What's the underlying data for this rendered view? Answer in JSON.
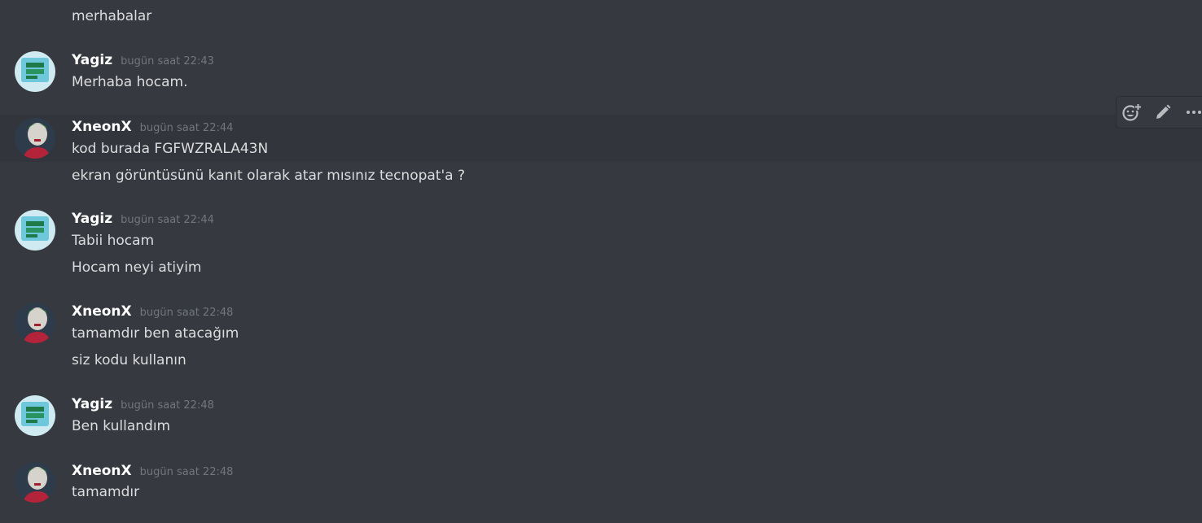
{
  "messages": [
    {
      "author": "",
      "time": "",
      "lines": [
        "merhabalar"
      ]
    },
    {
      "author": "Yagiz",
      "time": "bugün saat 22:43",
      "lines": [
        "Merhaba hocam."
      ]
    },
    {
      "author": "XneonX",
      "time": "bugün saat 22:44",
      "lines": [
        "kod burada FGFWZRALA43N",
        "ekran görüntüsünü kanıt olarak atar mısınız tecnopat'a ?"
      ]
    },
    {
      "author": "Yagiz",
      "time": "bugün saat 22:44",
      "lines": [
        "Tabii hocam",
        "Hocam neyi atiyim"
      ]
    },
    {
      "author": "XneonX",
      "time": "bugün saat 22:48",
      "lines": [
        "tamamdır ben atacağım",
        "siz kodu kullanın"
      ]
    },
    {
      "author": "Yagiz",
      "time": "bugün saat 22:48",
      "lines": [
        "Ben kullandım"
      ]
    },
    {
      "author": "XneonX",
      "time": "bugün saat 22:48",
      "lines": [
        "tamamdır"
      ]
    }
  ],
  "toolbar": {
    "icons": [
      "add-reaction-icon",
      "edit-icon",
      "more-icon"
    ]
  },
  "colors": {
    "background": "#36393f",
    "hover": "#32353b",
    "text": "#dcddde",
    "username": "#ffffff",
    "timestamp": "#72767d"
  }
}
